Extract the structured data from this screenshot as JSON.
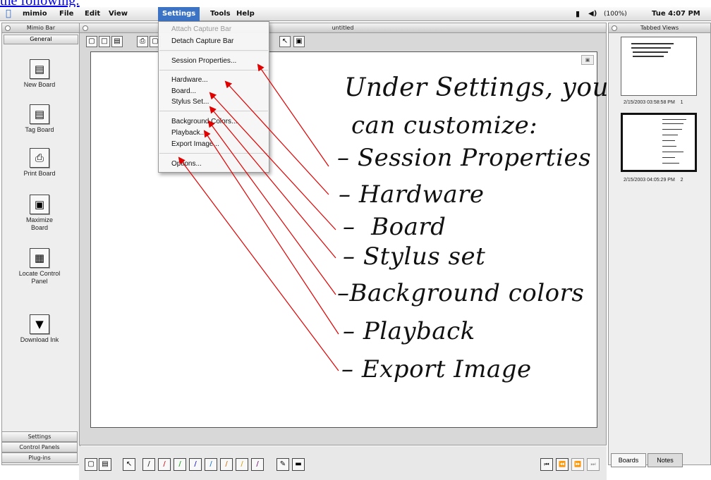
{
  "caption": "the following:",
  "menubar": {
    "app": "mimio",
    "items": [
      "File",
      "Edit",
      "View",
      "Settings",
      "Tools",
      "Help"
    ],
    "status": "(100%)",
    "clock": "Tue 4:07 PM"
  },
  "left_panel": {
    "title": "Mimio Bar",
    "tab": "General",
    "buttons": [
      {
        "label": "New Board",
        "icon": "new-board-icon"
      },
      {
        "label": "Tag Board",
        "icon": "tag-board-icon"
      },
      {
        "label": "Print Board",
        "icon": "print-board-icon"
      },
      {
        "label": "Maximize Board",
        "icon": "maximize-board-icon"
      },
      {
        "label": "Locate Control Panel",
        "icon": "locate-control-panel-icon"
      },
      {
        "label": "Download Ink",
        "icon": "download-ink-icon"
      }
    ],
    "bottom_tabs": [
      "Settings",
      "Control Panels",
      "Plug-ins"
    ]
  },
  "document": {
    "title": "untitled"
  },
  "settings_menu": {
    "items": [
      {
        "label": "Attach Capture Bar",
        "enabled": false
      },
      {
        "label": "Detach Capture Bar",
        "enabled": true
      },
      {
        "label": "Session Properties...",
        "enabled": true
      },
      {
        "label": "Hardware...",
        "enabled": true
      },
      {
        "label": "Board...",
        "enabled": true
      },
      {
        "label": "Stylus Set...",
        "enabled": true
      },
      {
        "label": "Background Colors...",
        "enabled": true
      },
      {
        "label": "Playback...",
        "enabled": true
      },
      {
        "label": "Export Image...",
        "enabled": true
      },
      {
        "label": "Options...",
        "enabled": true
      }
    ]
  },
  "whiteboard": {
    "heading_line1": "Under Settings, you",
    "heading_line2": "can customize:",
    "list": [
      "Session Properties",
      "Hardware",
      "Board",
      "Stylus set",
      "Background colors",
      "Playback",
      "Export Image"
    ]
  },
  "right_panel": {
    "title": "Tabbed Views",
    "thumbnails": [
      {
        "timestamp": "2/15/2003 03:58:58 PM",
        "index": "1"
      },
      {
        "timestamp": "2/15/2003 04:05:29 PM",
        "index": "2"
      }
    ],
    "tabs": [
      "Boards",
      "Notes"
    ]
  },
  "colors": {
    "accent": "#3d73c4",
    "arrow": "#e00000",
    "link": "#0000ee"
  }
}
